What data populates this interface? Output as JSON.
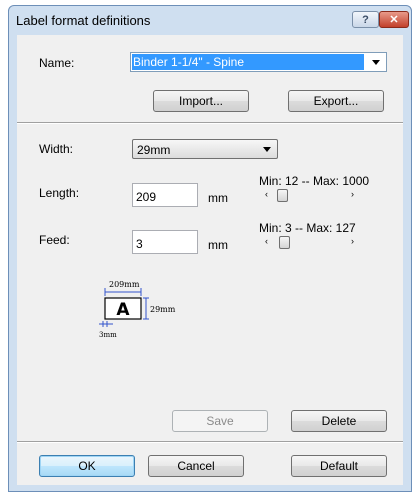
{
  "window": {
    "title": "Label format definitions",
    "help_glyph": "?",
    "close_glyph": "✕"
  },
  "name_field": {
    "label": "Name:",
    "value": "Binder 1-1/4\" - Spine"
  },
  "buttons": {
    "import": "Import...",
    "export": "Export...",
    "save": "Save",
    "delete": "Delete",
    "ok": "OK",
    "cancel": "Cancel",
    "default": "Default"
  },
  "width_field": {
    "label": "Width:",
    "value": "29mm"
  },
  "length_field": {
    "label": "Length:",
    "value": "209",
    "unit": "mm",
    "range": "Min: 12 -- Max: 1000"
  },
  "feed_field": {
    "label": "Feed:",
    "value": "3",
    "unit": "mm",
    "range": "Min: 3 -- Max: 127"
  },
  "sliders": {
    "left_glyph": "‹",
    "right_glyph": "›"
  },
  "preview": {
    "length_dim": "209mm",
    "width_dim": "29mm",
    "feed_dim": "3mm",
    "sample_letter": "A"
  }
}
